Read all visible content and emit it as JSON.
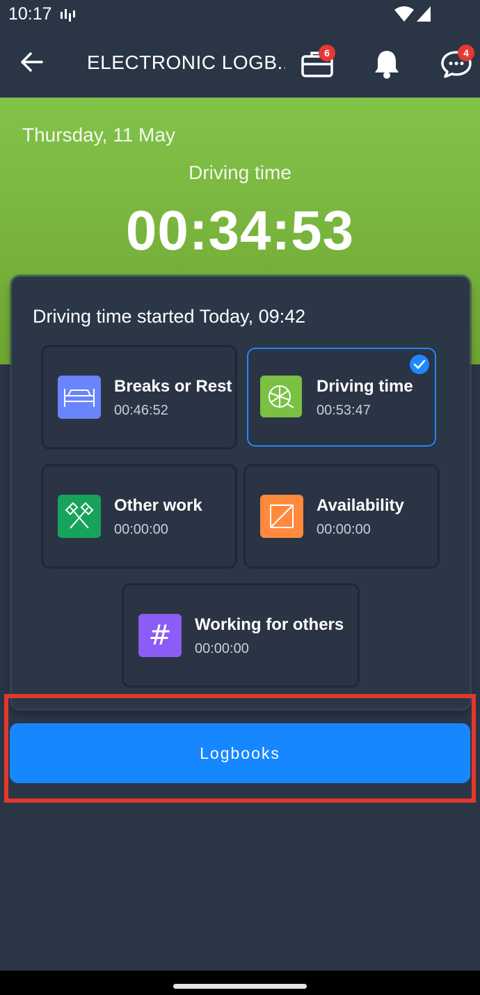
{
  "status_bar": {
    "time": "10:17"
  },
  "app_bar": {
    "title": "ELECTRONIC LOGB...",
    "briefcase_badge": "6",
    "messages_badge": "4"
  },
  "hero": {
    "date": "Thursday, 11 May",
    "label": "Driving time",
    "timer": "00:34:53"
  },
  "card": {
    "header": "Driving time started Today, 09:42",
    "activities": [
      {
        "title": "Breaks or Rest",
        "time": "00:46:52",
        "icon": "bed-icon",
        "color": "#6a85fb",
        "selected": false
      },
      {
        "title": "Driving time",
        "time": "00:53:47",
        "icon": "steering-wheel-icon",
        "color": "#7bc043",
        "selected": true
      },
      {
        "title": "Other work",
        "time": "00:00:00",
        "icon": "hammers-icon",
        "color": "#17a35c",
        "selected": false
      },
      {
        "title": "Availability",
        "time": "00:00:00",
        "icon": "availability-icon",
        "color": "#ff8a3d",
        "selected": false
      },
      {
        "title": "Working for others",
        "time": "00:00:00",
        "icon": "hash-icon",
        "color": "#8b5cf6",
        "selected": false
      }
    ]
  },
  "logbooks_button": {
    "label": "Logbooks"
  },
  "colors": {
    "background": "#2a3546",
    "accent": "#1787ff",
    "hero_green": "#7bc043",
    "highlight": "#e2372c",
    "badge": "#e53935"
  }
}
